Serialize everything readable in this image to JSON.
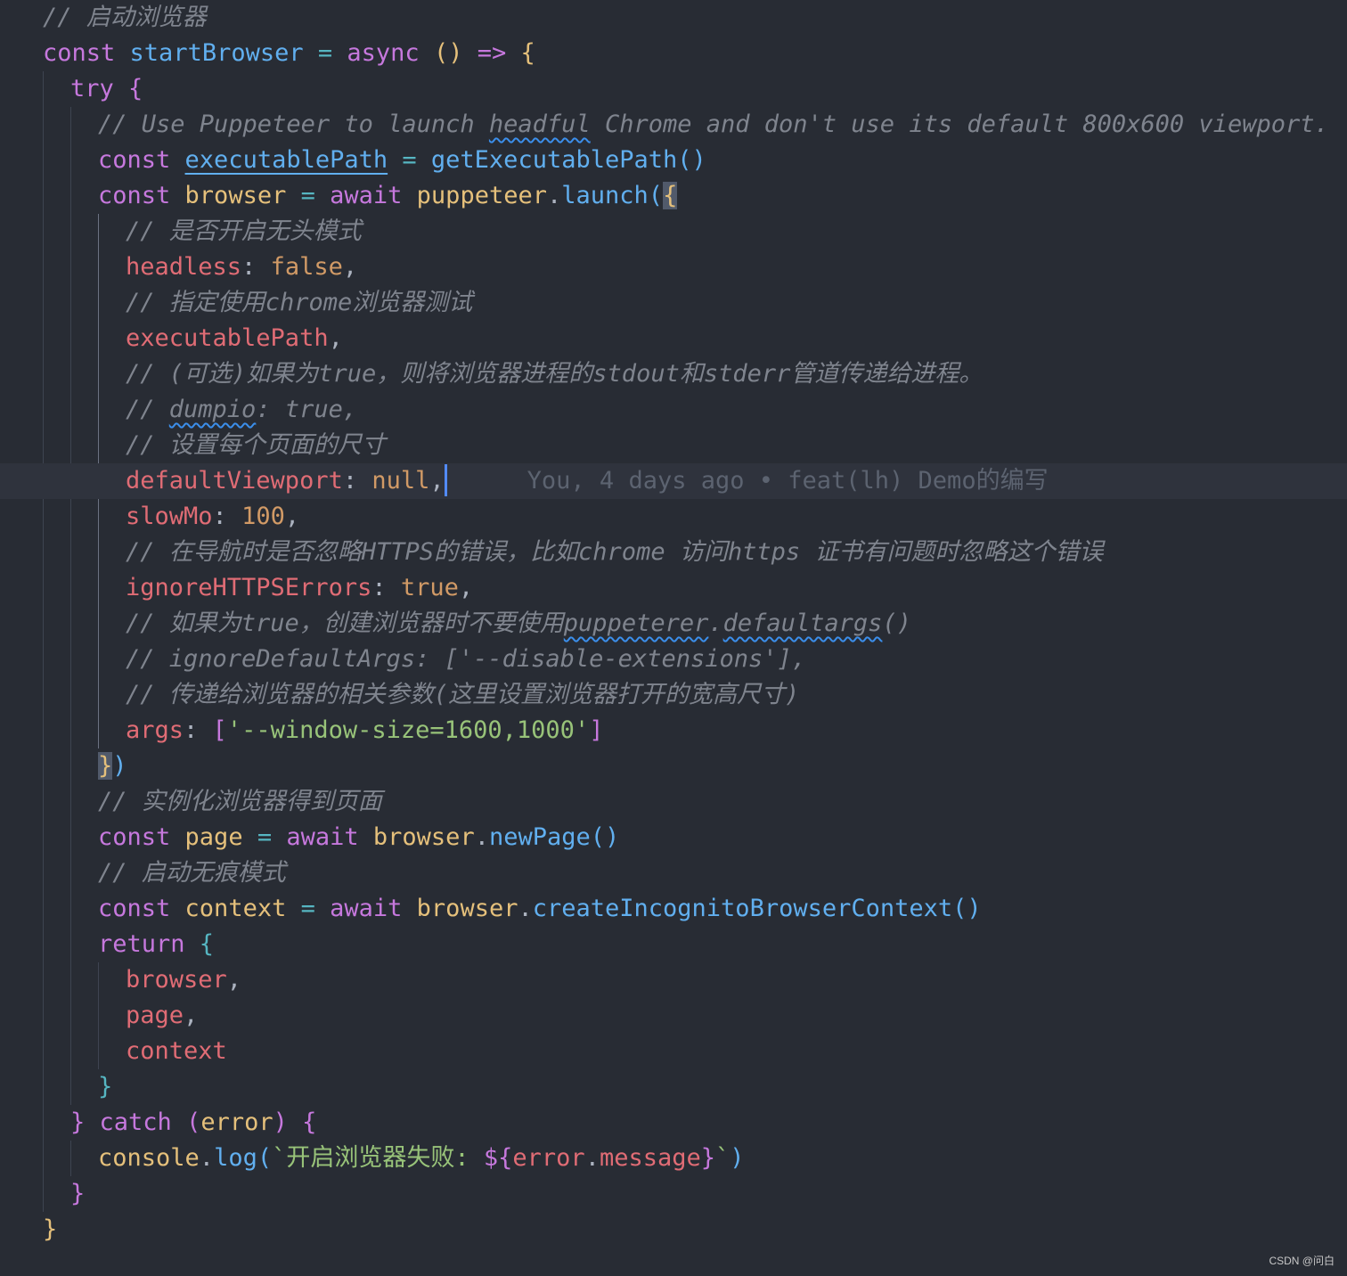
{
  "editor": {
    "theme_colors": {
      "background": "#282c34",
      "current_line": "#2f333d",
      "comment": "#7f848e",
      "keyword": "#c678dd",
      "function": "#61afef",
      "variable": "#e5c07b",
      "property": "#e06c75",
      "string": "#98c379",
      "number": "#d19a66",
      "operator": "#56b6c2",
      "punctuation": "#abb2bf",
      "cursor": "#528bff",
      "blame": "#5c6370"
    },
    "code_lines": [
      {
        "kind": "comment",
        "tokens": [
          {
            "text": "// 启动浏览器",
            "color": "#7f848e",
            "italic": true
          }
        ]
      },
      {
        "kind": "code",
        "tokens": [
          {
            "text": "const ",
            "color": "#c678dd"
          },
          {
            "text": "startBrowser",
            "color": "#61afef"
          },
          {
            "text": " = ",
            "color": "#56b6c2"
          },
          {
            "text": "async ",
            "color": "#c678dd"
          },
          {
            "text": "() ",
            "color": "#e5c07b"
          },
          {
            "text": "=> ",
            "color": "#c678dd"
          },
          {
            "text": "{",
            "color": "#e5c07b"
          }
        ]
      },
      {
        "kind": "code",
        "tokens": [
          {
            "text": "try ",
            "color": "#c678dd"
          },
          {
            "text": "{",
            "color": "#c678dd"
          }
        ]
      },
      {
        "kind": "comment",
        "tokens": [
          {
            "text": "// Use Puppeteer to launch ",
            "color": "#7f848e",
            "italic": true
          },
          {
            "text": "headful",
            "color": "#7f848e",
            "italic": true,
            "squiggle": true
          },
          {
            "text": " Chrome and don't use its default 800x600 viewport.",
            "color": "#7f848e",
            "italic": true
          }
        ]
      },
      {
        "kind": "code",
        "tokens": [
          {
            "text": "const ",
            "color": "#c678dd"
          },
          {
            "text": "executablePath",
            "color": "#61afef",
            "underline": true
          },
          {
            "text": " = ",
            "color": "#56b6c2"
          },
          {
            "text": "getExecutablePath",
            "color": "#61afef"
          },
          {
            "text": "()",
            "color": "#61afef"
          }
        ]
      },
      {
        "kind": "code",
        "tokens": [
          {
            "text": "const ",
            "color": "#c678dd"
          },
          {
            "text": "browser",
            "color": "#e5c07b"
          },
          {
            "text": " = ",
            "color": "#56b6c2"
          },
          {
            "text": "await ",
            "color": "#c678dd"
          },
          {
            "text": "puppeteer",
            "color": "#e5c07b"
          },
          {
            "text": ".",
            "color": "#abb2bf"
          },
          {
            "text": "launch",
            "color": "#61afef"
          },
          {
            "text": "(",
            "color": "#61afef"
          },
          {
            "text": "{",
            "color": "#e5c07b",
            "bracket_match": true
          }
        ]
      },
      {
        "kind": "comment",
        "tokens": [
          {
            "text": "// 是否开启无头模式",
            "color": "#7f848e",
            "italic": true
          }
        ]
      },
      {
        "kind": "code",
        "tokens": [
          {
            "text": "headless",
            "color": "#e06c75"
          },
          {
            "text": ": ",
            "color": "#abb2bf"
          },
          {
            "text": "false",
            "color": "#d19a66"
          },
          {
            "text": ",",
            "color": "#abb2bf"
          }
        ]
      },
      {
        "kind": "comment",
        "tokens": [
          {
            "text": "// 指定使用chrome浏览器测试",
            "color": "#7f848e",
            "italic": true
          }
        ]
      },
      {
        "kind": "code",
        "tokens": [
          {
            "text": "executablePath",
            "color": "#e06c75"
          },
          {
            "text": ",",
            "color": "#abb2bf"
          }
        ]
      },
      {
        "kind": "comment",
        "tokens": [
          {
            "text": "// (可选)如果为true，则将浏览器进程的stdout和stderr管道传递给进程。",
            "color": "#7f848e",
            "italic": true
          }
        ]
      },
      {
        "kind": "comment",
        "tokens": [
          {
            "text": "// ",
            "color": "#7f848e",
            "italic": true
          },
          {
            "text": "dumpio",
            "color": "#7f848e",
            "italic": true,
            "squiggle": true
          },
          {
            "text": ": true,",
            "color": "#7f848e",
            "italic": true
          }
        ]
      },
      {
        "kind": "comment",
        "tokens": [
          {
            "text": "// 设置每个页面的尺寸",
            "color": "#7f848e",
            "italic": true
          }
        ]
      },
      {
        "kind": "code",
        "current": true,
        "tokens": [
          {
            "text": "defaultViewport",
            "color": "#e06c75"
          },
          {
            "text": ": ",
            "color": "#abb2bf"
          },
          {
            "text": "null",
            "color": "#d19a66"
          },
          {
            "text": ",",
            "color": "#abb2bf"
          }
        ]
      },
      {
        "kind": "code",
        "tokens": [
          {
            "text": "slowMo",
            "color": "#e06c75"
          },
          {
            "text": ": ",
            "color": "#abb2bf"
          },
          {
            "text": "100",
            "color": "#d19a66"
          },
          {
            "text": ",",
            "color": "#abb2bf"
          }
        ]
      },
      {
        "kind": "comment",
        "tokens": [
          {
            "text": "// 在导航时是否忽略HTTPS的错误，比如chrome 访问https 证书有问题时忽略这个错误",
            "color": "#7f848e",
            "italic": true
          }
        ]
      },
      {
        "kind": "code",
        "tokens": [
          {
            "text": "ignoreHTTPSErrors",
            "color": "#e06c75"
          },
          {
            "text": ": ",
            "color": "#abb2bf"
          },
          {
            "text": "true",
            "color": "#d19a66"
          },
          {
            "text": ",",
            "color": "#abb2bf"
          }
        ]
      },
      {
        "kind": "comment",
        "tokens": [
          {
            "text": "// 如果为true，创建浏览器时不要使用",
            "color": "#7f848e",
            "italic": true
          },
          {
            "text": "puppeterer",
            "color": "#7f848e",
            "italic": true,
            "squiggle": true
          },
          {
            "text": ".",
            "color": "#7f848e",
            "italic": true
          },
          {
            "text": "defaultargs",
            "color": "#7f848e",
            "italic": true,
            "squiggle": true
          },
          {
            "text": "()",
            "color": "#7f848e",
            "italic": true
          }
        ]
      },
      {
        "kind": "comment",
        "tokens": [
          {
            "text": "// ignoreDefaultArgs: ['--disable-extensions'],",
            "color": "#7f848e",
            "italic": true
          }
        ]
      },
      {
        "kind": "comment",
        "tokens": [
          {
            "text": "// 传递给浏览器的相关参数(这里设置浏览器打开的宽高尺寸)",
            "color": "#7f848e",
            "italic": true
          }
        ]
      },
      {
        "kind": "code",
        "tokens": [
          {
            "text": "args",
            "color": "#e06c75"
          },
          {
            "text": ": ",
            "color": "#abb2bf"
          },
          {
            "text": "[",
            "color": "#c678dd"
          },
          {
            "text": "'--window-size=1600,1000'",
            "color": "#98c379"
          },
          {
            "text": "]",
            "color": "#c678dd"
          }
        ]
      },
      {
        "kind": "code",
        "tokens": [
          {
            "text": "}",
            "color": "#e5c07b",
            "bracket_match": true
          },
          {
            "text": ")",
            "color": "#61afef"
          }
        ]
      },
      {
        "kind": "comment",
        "tokens": [
          {
            "text": "// 实例化浏览器得到页面",
            "color": "#7f848e",
            "italic": true
          }
        ]
      },
      {
        "kind": "code",
        "tokens": [
          {
            "text": "const ",
            "color": "#c678dd"
          },
          {
            "text": "page",
            "color": "#e5c07b"
          },
          {
            "text": " = ",
            "color": "#56b6c2"
          },
          {
            "text": "await ",
            "color": "#c678dd"
          },
          {
            "text": "browser",
            "color": "#e5c07b"
          },
          {
            "text": ".",
            "color": "#abb2bf"
          },
          {
            "text": "newPage",
            "color": "#61afef"
          },
          {
            "text": "()",
            "color": "#61afef"
          }
        ]
      },
      {
        "kind": "comment",
        "tokens": [
          {
            "text": "// 启动无痕模式",
            "color": "#7f848e",
            "italic": true
          }
        ]
      },
      {
        "kind": "code",
        "tokens": [
          {
            "text": "const ",
            "color": "#c678dd"
          },
          {
            "text": "context",
            "color": "#e5c07b"
          },
          {
            "text": " = ",
            "color": "#56b6c2"
          },
          {
            "text": "await ",
            "color": "#c678dd"
          },
          {
            "text": "browser",
            "color": "#e5c07b"
          },
          {
            "text": ".",
            "color": "#abb2bf"
          },
          {
            "text": "createIncognitoBrowserContext",
            "color": "#61afef"
          },
          {
            "text": "()",
            "color": "#61afef"
          }
        ]
      },
      {
        "kind": "code",
        "tokens": [
          {
            "text": "return ",
            "color": "#c678dd"
          },
          {
            "text": "{",
            "color": "#56b6c2"
          }
        ]
      },
      {
        "kind": "code",
        "tokens": [
          {
            "text": "browser",
            "color": "#e06c75"
          },
          {
            "text": ",",
            "color": "#abb2bf"
          }
        ]
      },
      {
        "kind": "code",
        "tokens": [
          {
            "text": "page",
            "color": "#e06c75"
          },
          {
            "text": ",",
            "color": "#abb2bf"
          }
        ]
      },
      {
        "kind": "code",
        "tokens": [
          {
            "text": "context",
            "color": "#e06c75"
          }
        ]
      },
      {
        "kind": "code",
        "tokens": [
          {
            "text": "}",
            "color": "#56b6c2"
          }
        ]
      },
      {
        "kind": "code",
        "tokens": [
          {
            "text": "} ",
            "color": "#c678dd"
          },
          {
            "text": "catch ",
            "color": "#c678dd"
          },
          {
            "text": "(",
            "color": "#c678dd"
          },
          {
            "text": "error",
            "color": "#e5c07b"
          },
          {
            "text": ") ",
            "color": "#c678dd"
          },
          {
            "text": "{",
            "color": "#c678dd"
          }
        ]
      },
      {
        "kind": "code",
        "tokens": [
          {
            "text": "console",
            "color": "#e5c07b"
          },
          {
            "text": ".",
            "color": "#abb2bf"
          },
          {
            "text": "log",
            "color": "#61afef"
          },
          {
            "text": "(",
            "color": "#61afef"
          },
          {
            "text": "`开启浏览器失败: ",
            "color": "#98c379"
          },
          {
            "text": "${",
            "color": "#c678dd"
          },
          {
            "text": "error",
            "color": "#e06c75"
          },
          {
            "text": ".",
            "color": "#abb2bf"
          },
          {
            "text": "message",
            "color": "#e06c75"
          },
          {
            "text": "}",
            "color": "#c678dd"
          },
          {
            "text": "`",
            "color": "#98c379"
          },
          {
            "text": ")",
            "color": "#61afef"
          }
        ]
      },
      {
        "kind": "code",
        "tokens": [
          {
            "text": "}",
            "color": "#c678dd"
          }
        ]
      },
      {
        "kind": "code",
        "tokens": [
          {
            "text": "}",
            "color": "#e5c07b"
          }
        ]
      }
    ],
    "git_blame": {
      "author": "You",
      "time": "4 days ago",
      "separator_icon": "dot-icon",
      "message": "feat(lh) Demo的编写",
      "text": "You, 4 days ago • feat(lh) Demo的编写"
    }
  },
  "watermark": "CSDN @问白"
}
